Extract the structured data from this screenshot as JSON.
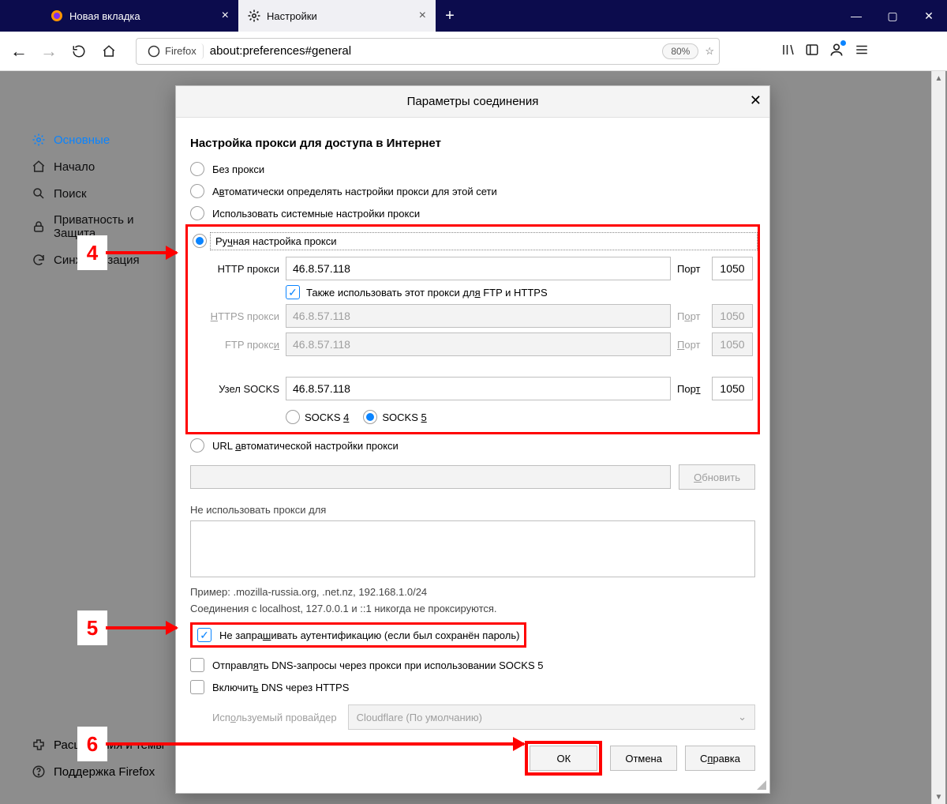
{
  "tabs": {
    "newtab_label": "Новая вкладка",
    "settings_label": "Настройки"
  },
  "toolbar": {
    "identity": "Firefox",
    "url": "about:preferences#general",
    "zoom": "80%"
  },
  "sidebar": {
    "items": [
      {
        "label": "Основные"
      },
      {
        "label": "Начало"
      },
      {
        "label": "Поиск"
      },
      {
        "label": "Приватность и Защита"
      },
      {
        "label": "Синхронизация"
      }
    ],
    "extensions": "Расширения и темы",
    "support": "Поддержка Firefox"
  },
  "dialog": {
    "title": "Параметры соединения",
    "section": "Настройка прокси для доступа в Интернет",
    "opts": {
      "none": "Без прокси",
      "auto": "Автоматически определять настройки прокси для этой сети",
      "system": "Использовать системные настройки прокси",
      "manual": "Ручная настройка прокси",
      "pac": "URL автоматической настройки прокси"
    },
    "http_label": "HTTP прокси",
    "https_label": "HTTPS прокси",
    "ftp_label": "FTP прокси",
    "socks_label": "Узел SOCKS",
    "port_label": "Порт",
    "share_label": "Также использовать этот прокси для FTP и HTTPS",
    "socks4": "SOCKS 4",
    "socks5": "SOCKS 5",
    "refresh": "Обновить",
    "noproxy_label": "Не использовать прокси для",
    "example": "Пример: .mozilla-russia.org, .net.nz, 192.168.1.0/24",
    "localhost_note": "Соединения с localhost, 127.0.0.1 и ::1 никогда не проксируются.",
    "no_auth": "Не запрашивать аутентификацию (если был сохранён пароль)",
    "dns_socks": "Отправлять DNS-запросы через прокси при использовании SOCKS 5",
    "dns_https": "Включить DNS через HTTPS",
    "provider_label": "Используемый провайдер",
    "provider_value": "Cloudflare (По умолчанию)",
    "ok": "ОК",
    "cancel": "Отмена",
    "help": "Справка",
    "values": {
      "http_host": "46.8.57.118",
      "http_port": "1050",
      "https_host": "46.8.57.118",
      "https_port": "1050",
      "ftp_host": "46.8.57.118",
      "ftp_port": "1050",
      "socks_host": "46.8.57.118",
      "socks_port": "1050"
    }
  },
  "callouts": {
    "c4": "4",
    "c5": "5",
    "c6": "6"
  }
}
